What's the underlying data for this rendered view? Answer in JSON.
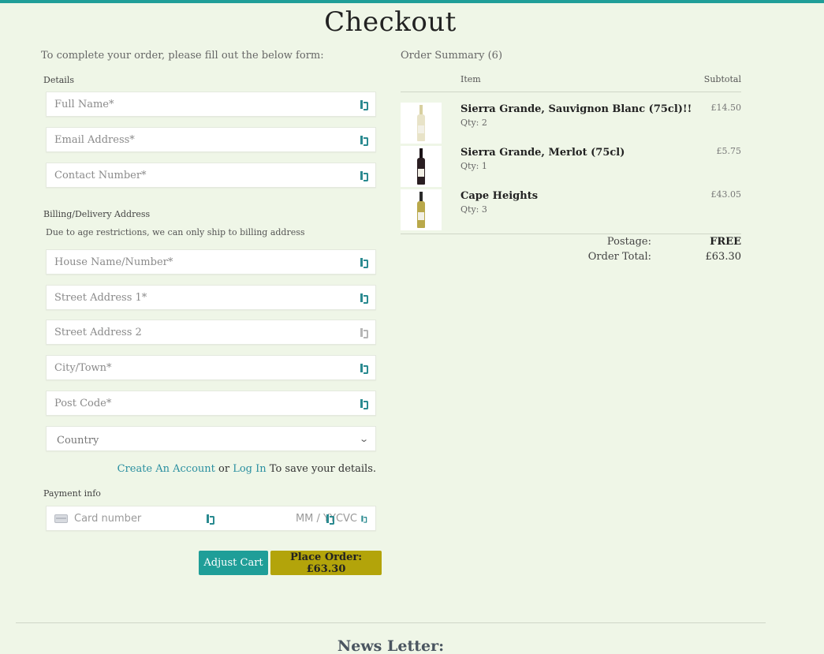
{
  "page": {
    "title": "Checkout",
    "intro": "To complete your order, please fill out the below form:"
  },
  "details": {
    "label": "Details",
    "full_name_placeholder": "Full Name*",
    "email_placeholder": "Email Address*",
    "contact_placeholder": "Contact Number*"
  },
  "address": {
    "label": "Billing/Delivery Address",
    "note": "Due to age restrictions, we can only ship to billing address",
    "house_placeholder": "House Name/Number*",
    "street1_placeholder": "Street Address 1*",
    "street2_placeholder": "Street Address 2",
    "city_placeholder": "City/Town*",
    "postcode_placeholder": "Post Code*",
    "country_value": "Country"
  },
  "account": {
    "create_link": "Create An Account",
    "or_text": "or",
    "login_link": "Log In",
    "suffix": "To save your details."
  },
  "payment": {
    "label": "Payment info",
    "card_placeholder": "Card number",
    "expiry_placeholder": "MM / YY",
    "cvc_placeholder": "CVC"
  },
  "buttons": {
    "adjust_cart": "Adjust Cart",
    "place_order": "Place Order: £63.30"
  },
  "summary": {
    "title": "Order Summary (6)",
    "col_item": "Item",
    "col_subtotal": "Subtotal",
    "items": [
      {
        "name": "Sierra Grande, Sauvignon Blanc (75cl)!!",
        "qty": "Qty: 2",
        "price": "£14.50",
        "bottle_color": "#e8e3c8",
        "icon": "white-wine-bottle-icon"
      },
      {
        "name": "Sierra Grande, Merlot (75cl)",
        "qty": "Qty: 1",
        "price": "£5.75",
        "bottle_color": "#2a1e22",
        "icon": "red-wine-bottle-icon"
      },
      {
        "name": "Cape Heights",
        "qty": "Qty: 3",
        "price": "£43.05",
        "bottle_color": "#b9a84a",
        "icon": "white-wine-bottle-icon"
      }
    ],
    "postage_label": "Postage:",
    "postage_value": "FREE",
    "total_label": "Order Total:",
    "total_value": "£63.30"
  },
  "footer": {
    "newsletter_title": "News Letter:"
  },
  "colors": {
    "accent": "#1f9e98",
    "place_order": "#b3a40a",
    "background": "#eff6e7"
  }
}
